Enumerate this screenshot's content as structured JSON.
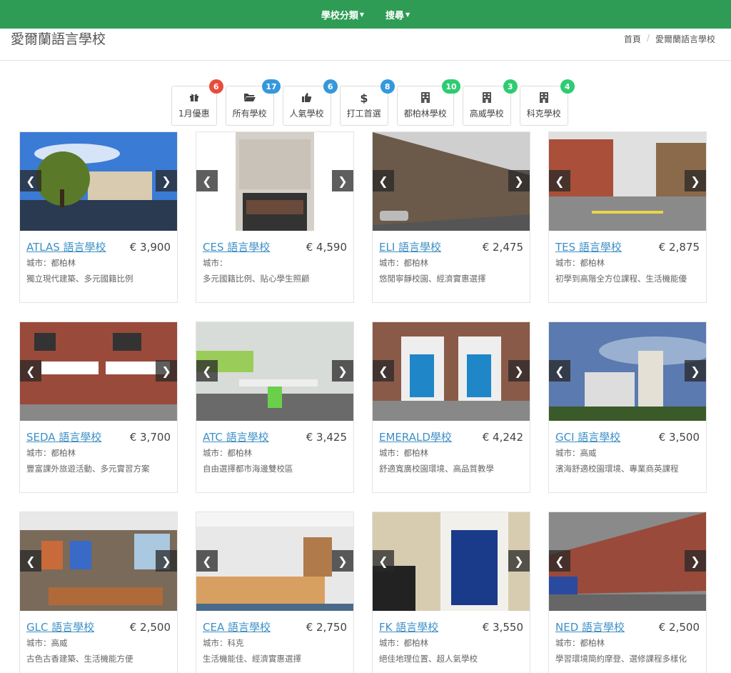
{
  "nav": {
    "items": [
      {
        "label": "學校分類"
      },
      {
        "label": "搜尋"
      }
    ]
  },
  "header": {
    "title": "愛爾蘭語言學校"
  },
  "breadcrumb": {
    "home": "首頁",
    "current": "愛爾蘭語言學校"
  },
  "filters": [
    {
      "label": "1月優惠",
      "count": "6",
      "badge_color": "#e74c3c",
      "icon": "gift-icon"
    },
    {
      "label": "所有學校",
      "count": "17",
      "badge_color": "#3498db",
      "icon": "folder-open-icon"
    },
    {
      "label": "人氣學校",
      "count": "6",
      "badge_color": "#3498db",
      "icon": "thumbs-up-icon"
    },
    {
      "label": "打工首選",
      "count": "8",
      "badge_color": "#3498db",
      "icon": "dollar-icon"
    },
    {
      "label": "都柏林學校",
      "count": "10",
      "badge_color": "#2ecc71",
      "icon": "building-icon"
    },
    {
      "label": "高威學校",
      "count": "3",
      "badge_color": "#2ecc71",
      "icon": "building-icon"
    },
    {
      "label": "科克學校",
      "count": "4",
      "badge_color": "#2ecc71",
      "icon": "building-icon"
    }
  ],
  "schools": [
    {
      "name": "ATLAS 語言學校",
      "price": "€ 3,900",
      "city": "城市：都柏林",
      "desc": "獨立現代建築、多元國籍比例"
    },
    {
      "name": "CES 語言學校",
      "price": "€ 4,590",
      "city": "城市：",
      "desc": "多元國籍比例、貼心學生照顧"
    },
    {
      "name": "ELI 語言學校",
      "price": "€ 2,475",
      "city": "城市：都柏林",
      "desc": "悠閒寧靜校園、經濟實惠選擇"
    },
    {
      "name": "TES 語言學校",
      "price": "€ 2,875",
      "city": "城市：都柏林",
      "desc": "初學到高階全方位課程、生活機能優"
    },
    {
      "name": "SEDA 語言學校",
      "price": "€ 3,700",
      "city": "城市：都柏林",
      "desc": "豐富課外旅遊活動、多元實習方案"
    },
    {
      "name": "ATC 語言學校",
      "price": "€ 3,425",
      "city": "城市：都柏林",
      "desc": "自由選擇都市海邊雙校區"
    },
    {
      "name": "EMERALD學校",
      "price": "€ 4,242",
      "city": "城市：都柏林",
      "desc": "舒適寬廣校園環境、高品質教學"
    },
    {
      "name": "GCI 語言學校",
      "price": "€ 3,500",
      "city": "城市：高威",
      "desc": "濱海舒適校園環境、專業商英課程"
    },
    {
      "name": "GLC 語言學校",
      "price": "€ 2,500",
      "city": "城市：高威",
      "desc": "古色古香建築、生活機能方便"
    },
    {
      "name": "CEA 語言學校",
      "price": "€ 2,750",
      "city": "城市：科克",
      "desc": "生活機能佳、經濟實惠選擇"
    },
    {
      "name": "FK 語言學校",
      "price": "€ 3,550",
      "city": "城市：都柏林",
      "desc": "絕佳地理位置、超人氣學校"
    },
    {
      "name": "NED 語言學校",
      "price": "€ 2,500",
      "city": "城市：都柏林",
      "desc": "學習環境簡約摩登、選修課程多樣化"
    }
  ],
  "colors": {
    "nav_bg": "#2e9c54",
    "link": "#3c8fc6"
  }
}
